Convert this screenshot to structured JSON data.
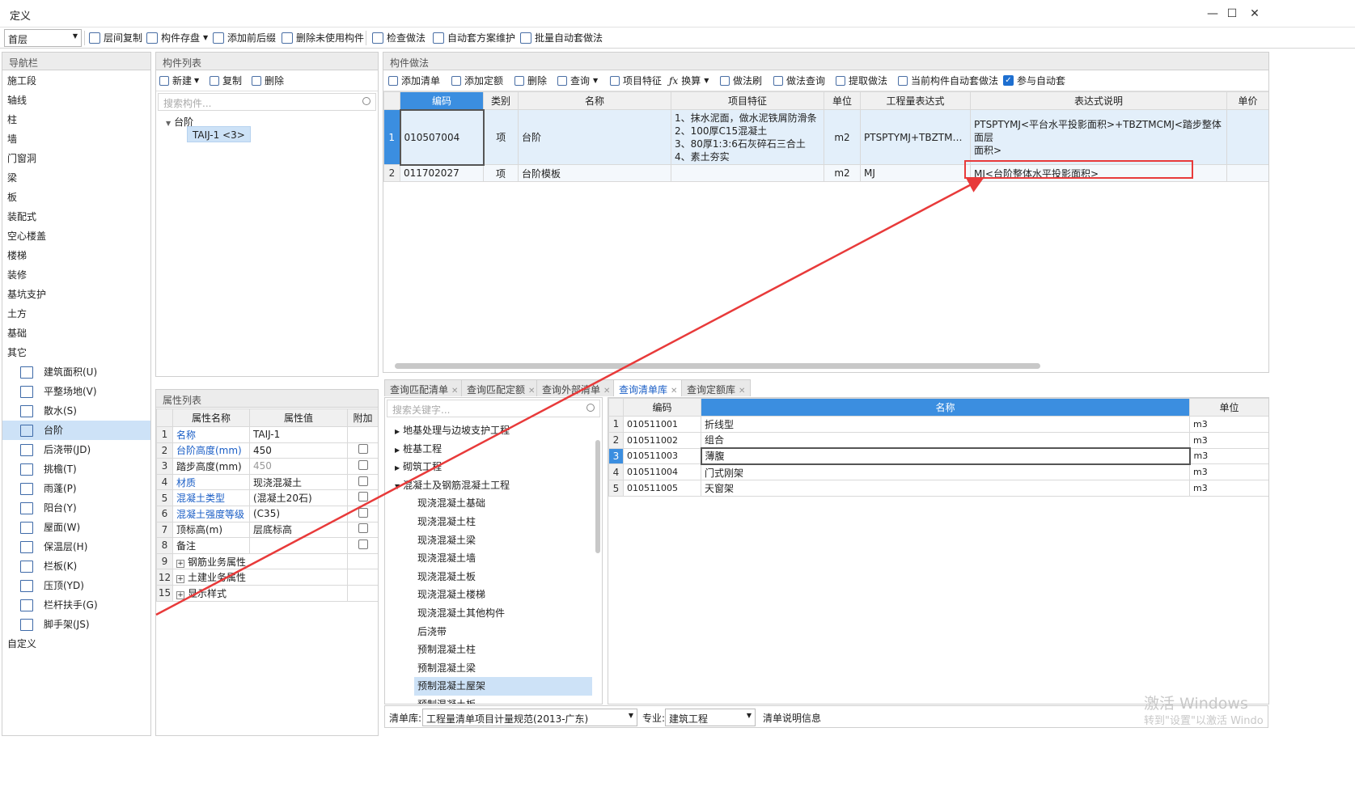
{
  "window": {
    "title": "定义"
  },
  "toolbar": {
    "floor": "首层",
    "buttons": [
      "层间复制",
      "构件存盘",
      "添加前后缀",
      "删除未使用构件",
      "检查做法",
      "自动套方案维护",
      "批量自动套做法"
    ]
  },
  "nav": {
    "title": "导航栏",
    "items": [
      "施工段",
      "轴线",
      "柱",
      "墙",
      "门窗洞",
      "梁",
      "板",
      "装配式",
      "空心楼盖",
      "楼梯",
      "装修",
      "基坑支护",
      "土方",
      "基础",
      "其它"
    ],
    "sub": [
      "建筑面积(U)",
      "平整场地(V)",
      "散水(S)",
      "台阶",
      "后浇带(JD)",
      "挑檐(T)",
      "雨蓬(P)",
      "阳台(Y)",
      "屋面(W)",
      "保温层(H)",
      "栏板(K)",
      "压顶(YD)",
      "栏杆扶手(G)",
      "脚手架(JS)"
    ],
    "last": "自定义"
  },
  "complist": {
    "title": "构件列表",
    "new": "新建",
    "copy": "复制",
    "delete": "删除",
    "search_ph": "搜索构件...",
    "root": "台阶",
    "child": "TAIJ-1 <3>"
  },
  "props": {
    "title": "属性列表",
    "headers": [
      "属性名称",
      "属性值",
      "附加"
    ],
    "rows": [
      {
        "n": "1",
        "name": "名称",
        "val": "TAIJ-1",
        "blue": true,
        "chk": false,
        "gray": false,
        "plus": false
      },
      {
        "n": "2",
        "name": "台阶高度(mm)",
        "val": "450",
        "blue": true,
        "chk": true,
        "gray": false,
        "plus": false
      },
      {
        "n": "3",
        "name": "踏步高度(mm)",
        "val": "450",
        "blue": false,
        "chk": true,
        "gray": true,
        "plus": false
      },
      {
        "n": "4",
        "name": "材质",
        "val": "现浇混凝土",
        "blue": true,
        "chk": true,
        "gray": false,
        "plus": false
      },
      {
        "n": "5",
        "name": "混凝土类型",
        "val": "(混凝土20石)",
        "blue": true,
        "chk": true,
        "gray": false,
        "plus": false
      },
      {
        "n": "6",
        "name": "混凝土强度等级",
        "val": "(C35)",
        "blue": true,
        "chk": true,
        "gray": false,
        "plus": false
      },
      {
        "n": "7",
        "name": "顶标高(m)",
        "val": "层底标高",
        "blue": false,
        "chk": true,
        "gray": false,
        "plus": false
      },
      {
        "n": "8",
        "name": "备注",
        "val": "",
        "blue": false,
        "chk": true,
        "gray": false,
        "plus": false
      },
      {
        "n": "9",
        "name": "钢筋业务属性",
        "val": "",
        "blue": false,
        "chk": false,
        "gray": false,
        "plus": true
      },
      {
        "n": "12",
        "name": "土建业务属性",
        "val": "",
        "blue": false,
        "chk": false,
        "gray": false,
        "plus": true
      },
      {
        "n": "15",
        "name": "显示样式",
        "val": "",
        "blue": false,
        "chk": false,
        "gray": false,
        "plus": true
      }
    ]
  },
  "method": {
    "title": "构件做法",
    "buttons": [
      "添加清单",
      "添加定额",
      "删除",
      "查询",
      "项目特征",
      "换算",
      "做法刷",
      "做法查询",
      "提取做法",
      "当前构件自动套做法",
      "参与自动套"
    ],
    "headers": [
      "编码",
      "类别",
      "名称",
      "项目特征",
      "单位",
      "工程量表达式",
      "表达式说明",
      "单价"
    ],
    "rows": [
      {
        "n": "1",
        "code": "010507004",
        "type": "项",
        "name": "台阶",
        "feat": [
          "1、抹水泥面，做水泥铁屑防滑条",
          "2、100厚C15混凝土",
          "3、80厚1:3:6石灰碎石三合土",
          "4、素土夯实"
        ],
        "unit": "m2",
        "expr": "PTSPTYMJ+TBZTMCMJ",
        "desc": [
          "PTSPTYMJ<平台水平投影面积>+TBZTMCMJ<踏步整体面层",
          "面积>"
        ]
      },
      {
        "n": "2",
        "code": "011702027",
        "type": "项",
        "name": "台阶模板",
        "feat": [],
        "unit": "m2",
        "expr": "MJ",
        "desc": [
          "MJ<台阶整体水平投影面积>"
        ]
      }
    ]
  },
  "query": {
    "tabs": [
      "查询匹配清单",
      "查询匹配定额",
      "查询外部清单",
      "查询清单库",
      "查询定额库"
    ],
    "search_ph": "搜索关键字...",
    "tree": [
      "地基处理与边坡支护工程",
      "桩基工程",
      "砌筑工程",
      "混凝土及钢筋混凝土工程",
      "现浇混凝土基础",
      "现浇混凝土柱",
      "现浇混凝土梁",
      "现浇混凝土墙",
      "现浇混凝土板",
      "现浇混凝土楼梯",
      "现浇混凝土其他构件",
      "后浇带",
      "预制混凝土柱",
      "预制混凝土梁",
      "预制混凝土屋架",
      "预制混凝土板"
    ],
    "headers": [
      "编码",
      "名称",
      "单位"
    ],
    "rows": [
      {
        "n": "1",
        "code": "010511001",
        "name": "折线型",
        "unit": "m3"
      },
      {
        "n": "2",
        "code": "010511002",
        "name": "组合",
        "unit": "m3"
      },
      {
        "n": "3",
        "code": "010511003",
        "name": "薄腹",
        "unit": "m3"
      },
      {
        "n": "4",
        "code": "010511004",
        "name": "门式刚架",
        "unit": "m3"
      },
      {
        "n": "5",
        "code": "010511005",
        "name": "天窗架",
        "unit": "m3"
      }
    ]
  },
  "bottom": {
    "lib_label": "清单库:",
    "lib_value": "工程量清单项目计量规范(2013-广东)",
    "spec_label": "专业:",
    "spec_value": "建筑工程",
    "info": "清单说明信息"
  },
  "watermark": {
    "line1": "激活 Windows",
    "line2": "转到\"设置\"以激活 Windo"
  },
  "colors": {
    "accent": "#3b8ee0",
    "annotation": "#e83a3a",
    "selected": "#cde2f7"
  }
}
